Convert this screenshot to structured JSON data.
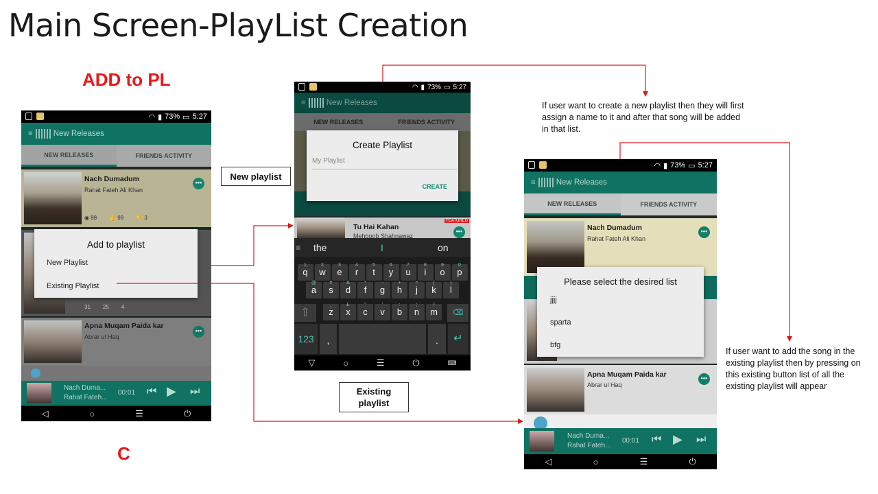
{
  "slide": {
    "title": "Main Screen-PlayList Creation",
    "add_to_pl": "ADD to PL",
    "c_label": "C"
  },
  "notes": {
    "new_playlist_box": "New playlist",
    "existing_playlist_box": "Existing playlist",
    "create_note": "If user want to create a new playlist  then they will first assign a name to it and after that song will be added in that list.",
    "existing_note": "If user want to add the song in the existing playlist then by pressing on this existing button list of all the existing playlist will appear"
  },
  "status": {
    "battery": "73%",
    "time": "5:27"
  },
  "app": {
    "title": "New Releases",
    "tab_new": "NEW RELEASES",
    "tab_friends": "FRIENDS ACTIVITY"
  },
  "phone1": {
    "song1": {
      "title": "Nach Dumadum",
      "artist": "Rahat Fateh Ali Khan",
      "views": "88",
      "likes": "98",
      "dislikes": "3"
    },
    "song2": {
      "views": "31",
      "likes": "25",
      "dislikes": "4"
    },
    "song3": {
      "title": "Apna Muqam Paida kar",
      "artist": "Abrar ul Haq"
    },
    "player": {
      "title": "Nach Duma...",
      "artist": "Rahat Fateh...",
      "time": "00:01"
    },
    "dialog": {
      "title": "Add to playlist",
      "new": "New Playlist",
      "existing": "Existing Playlist"
    }
  },
  "phone2": {
    "dialog": {
      "title": "Create Playlist",
      "placeholder": "My Playlist",
      "create": "CREATE"
    },
    "song": {
      "title": "Tu Hai Kahan",
      "artist": "Mehboob Shahnawaz",
      "badge": "FEATURED"
    },
    "keyboard": {
      "suggestions": [
        "the",
        "I",
        "on"
      ],
      "row1": [
        "q",
        "w",
        "e",
        "r",
        "t",
        "y",
        "u",
        "i",
        "o",
        "p"
      ],
      "row1_hints": [
        "1",
        "2",
        "3",
        "4",
        "5",
        "6",
        "7",
        "8",
        "9",
        "0"
      ],
      "row2": [
        "a",
        "s",
        "d",
        "f",
        "g",
        "h",
        "j",
        "k",
        "l"
      ],
      "row2_hints": [
        "@",
        "#",
        "&",
        "*",
        "-",
        "+",
        "=",
        "(",
        ")"
      ],
      "row3": [
        "z",
        "x",
        "c",
        "v",
        "b",
        "n",
        "m"
      ],
      "row3_hints": [
        "_",
        "£",
        "\"",
        "'",
        ":",
        ";",
        "/"
      ],
      "num_key": "123",
      "comma": ",",
      "period": "."
    }
  },
  "phone3": {
    "song1": {
      "title": "Nach Dumadum",
      "artist": "Rahat Fateh Ali Khan"
    },
    "song3": {
      "title": "Apna Muqam Paida kar",
      "artist": "Abrar ul Haq"
    },
    "player": {
      "title": "Nach Duma...",
      "artist": "Rahat Fateh...",
      "time": "00:01"
    },
    "dialog": {
      "title": "Please select the desired list",
      "items": [
        "jjjj",
        "sparta",
        "bfg"
      ]
    }
  },
  "colors": {
    "accent": "#0f7262",
    "arrow": "#d81b1b",
    "label_red": "#e8191a"
  }
}
